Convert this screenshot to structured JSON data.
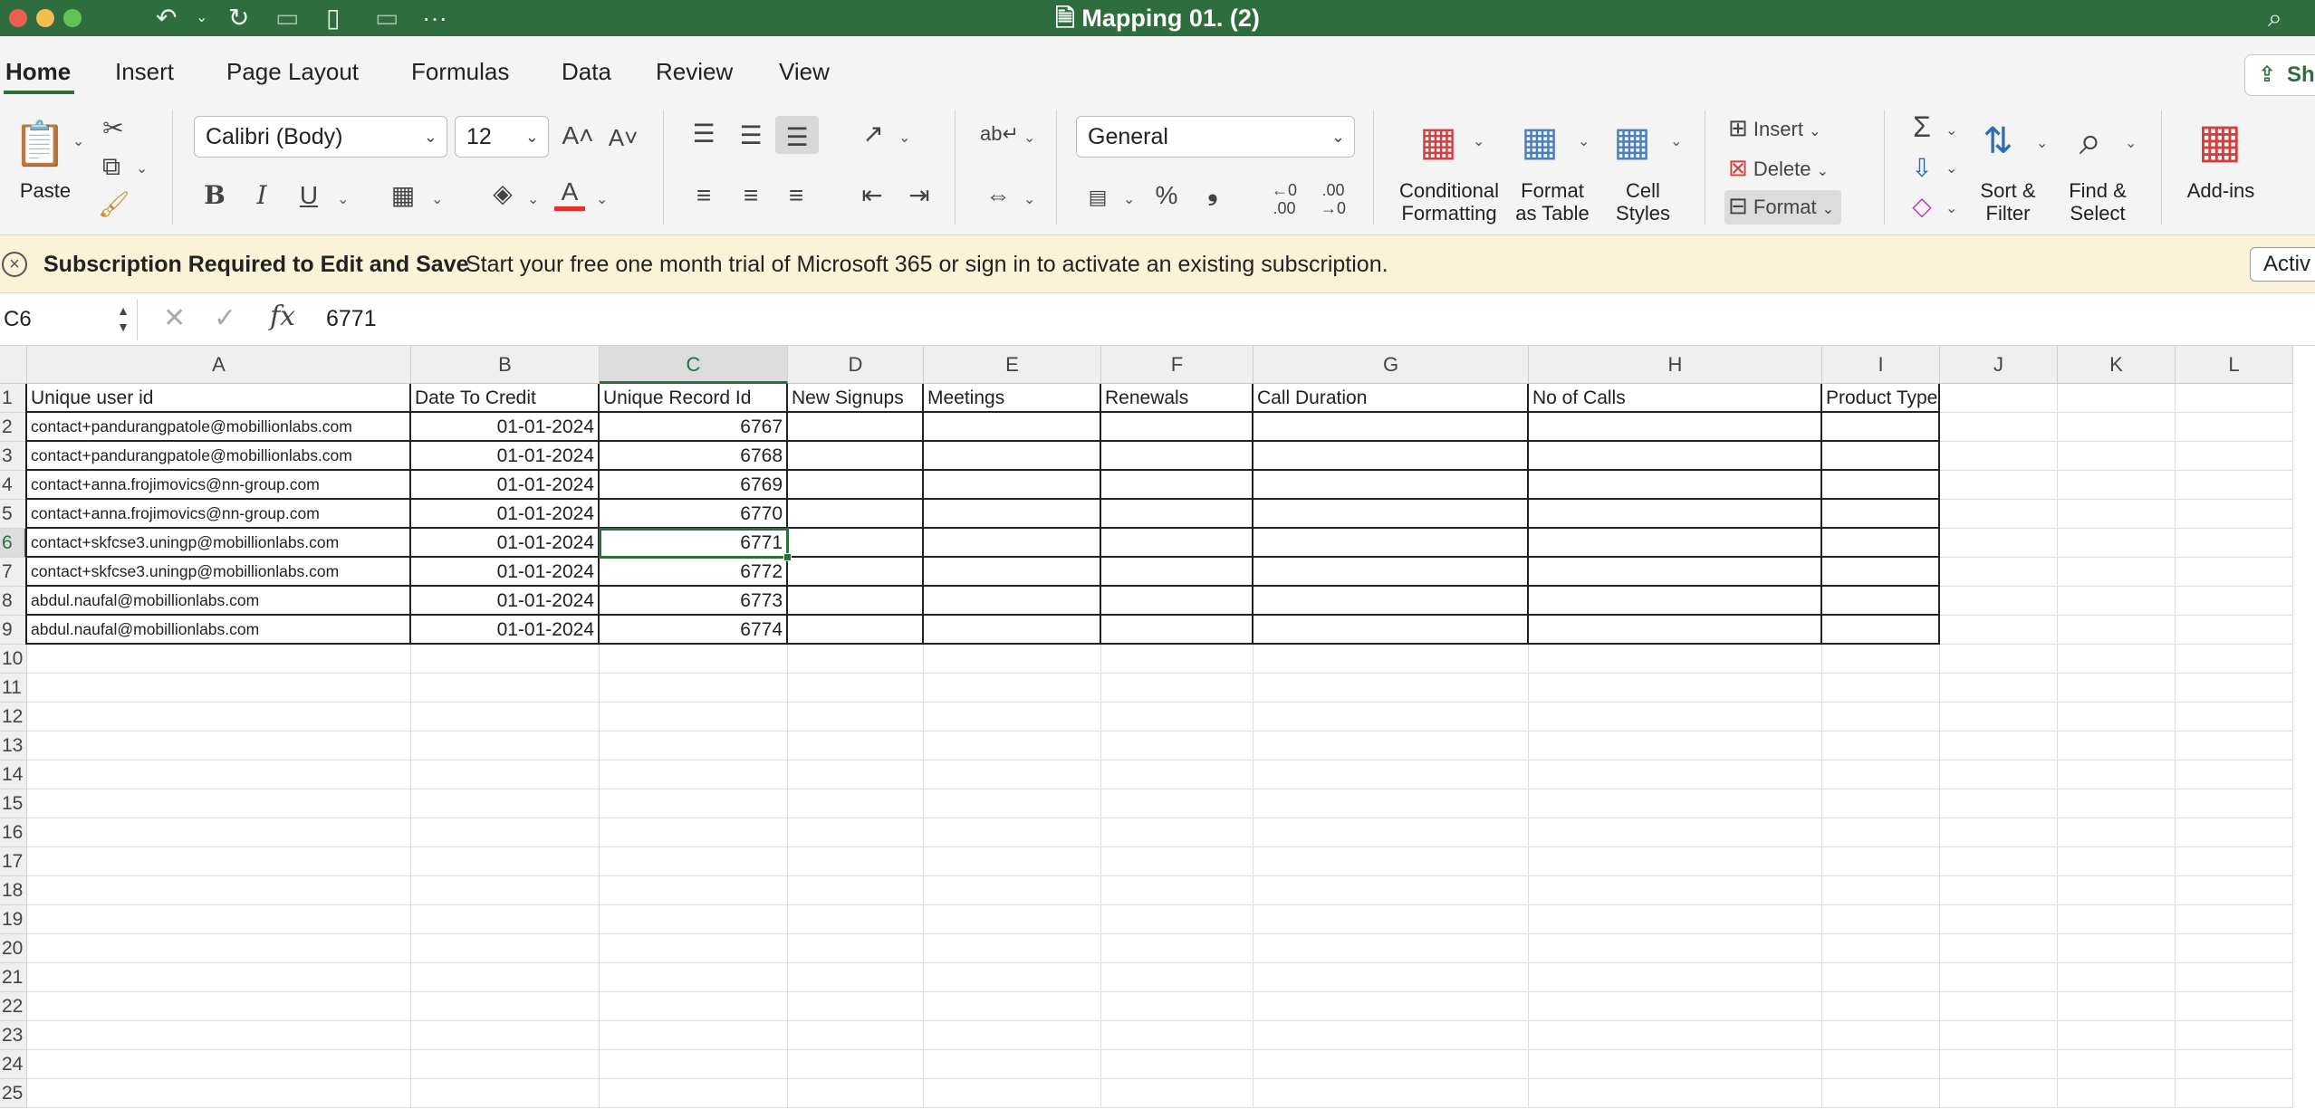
{
  "window": {
    "title": "Mapping 01. (2)"
  },
  "tabs": [
    "Home",
    "Insert",
    "Page Layout",
    "Formulas",
    "Data",
    "Review",
    "View"
  ],
  "share_label": "Sh",
  "ribbon": {
    "paste": "Paste",
    "font_name": "Calibri (Body)",
    "font_size": "12",
    "bold": "B",
    "italic": "I",
    "underline": "U",
    "grow_font": "A",
    "shrink_font": "A",
    "number_format": "General",
    "percent": "%",
    "comma": "❟",
    "conditional_formatting": [
      "Conditional",
      "Formatting"
    ],
    "format_as_table": [
      "Format",
      "as Table"
    ],
    "cell_styles": [
      "Cell",
      "Styles"
    ],
    "insert": "Insert",
    "delete": "Delete",
    "format": "Format",
    "sort_filter": [
      "Sort &",
      "Filter"
    ],
    "find_select": [
      "Find &",
      "Select"
    ],
    "addins": "Add-ins",
    "dec_inc": ".00",
    "dec_dec": ".00"
  },
  "banner": {
    "title": "Subscription Required to Edit and Save",
    "message": "Start your free one month trial of Microsoft 365 or sign in to activate an existing subscription.",
    "action": "Activ"
  },
  "formula_bar": {
    "name_box": "C6",
    "value": "6771",
    "fx": "fx"
  },
  "sheet": {
    "columns": [
      "A",
      "B",
      "C",
      "D",
      "E",
      "F",
      "G",
      "H",
      "I",
      "J",
      "K",
      "L"
    ],
    "selected_column": "C",
    "selected_row": 6,
    "headers": [
      "Unique user id",
      "Date To Credit",
      "Unique Record Id",
      "New Signups",
      "Meetings",
      "Renewals",
      "Call Duration",
      "No of Calls",
      "Product Type"
    ],
    "rows": [
      {
        "email": "contact+pandurangpatole@mobillionlabs.com",
        "date": "01-01-2024",
        "id": "6767"
      },
      {
        "email": "contact+pandurangpatole@mobillionlabs.com",
        "date": "01-01-2024",
        "id": "6768"
      },
      {
        "email": "contact+anna.frojimovics@nn-group.com",
        "date": "01-01-2024",
        "id": "6769"
      },
      {
        "email": "contact+anna.frojimovics@nn-group.com",
        "date": "01-01-2024",
        "id": "6770"
      },
      {
        "email": "contact+skfcse3.uningp@mobillionlabs.com",
        "date": "01-01-2024",
        "id": "6771"
      },
      {
        "email": "contact+skfcse3.uningp@mobillionlabs.com",
        "date": "01-01-2024",
        "id": "6772"
      },
      {
        "email": "abdul.naufal@mobillionlabs.com",
        "date": "01-01-2024",
        "id": "6773"
      },
      {
        "email": "abdul.naufal@mobillionlabs.com",
        "date": "01-01-2024",
        "id": "6774"
      }
    ],
    "row_numbers": [
      "1",
      "2",
      "3",
      "4",
      "5",
      "6",
      "7",
      "8",
      "9",
      "10",
      "11",
      "12",
      "13",
      "14",
      "15",
      "16",
      "17",
      "18",
      "19",
      "20",
      "21",
      "22",
      "23",
      "24",
      "25"
    ]
  }
}
